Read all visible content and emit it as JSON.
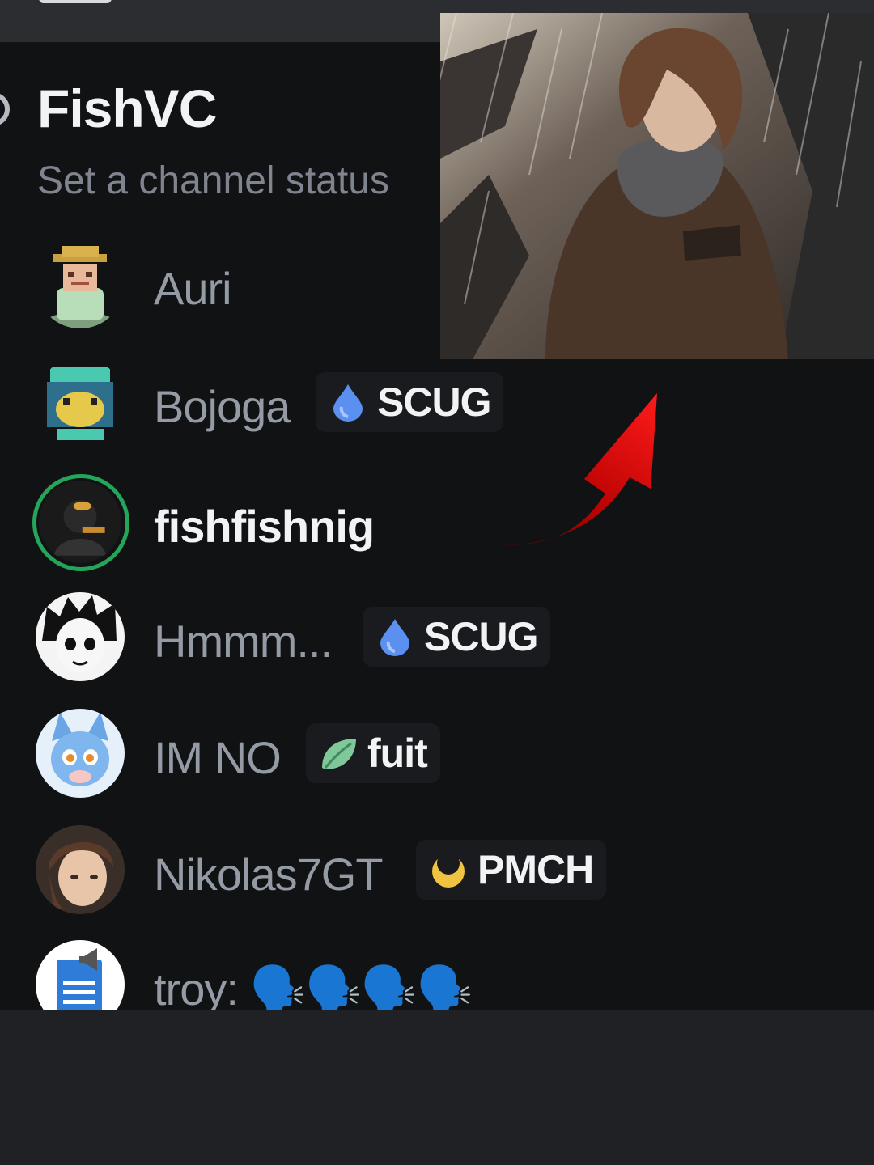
{
  "channel": {
    "name": "FishVC",
    "status_placeholder": "Set a channel status"
  },
  "members": [
    {
      "name": "Auri",
      "avatar": "pixel-straw-hat-avatar"
    },
    {
      "name": "Bojoga",
      "avatar": "pixel-frog-avatar",
      "tag": {
        "icon": "water-drop-icon",
        "label": "SCUG"
      }
    },
    {
      "name": "fishfishnig",
      "avatar": "dark-silhouette-avatar",
      "speaking": true
    },
    {
      "name": "Hmmm...",
      "avatar": "anime-boy-avatar",
      "tag": {
        "icon": "water-drop-icon",
        "label": "SCUG"
      }
    },
    {
      "name": "IM NO",
      "avatar": "blue-fox-avatar",
      "tag": {
        "icon": "leaf-icon",
        "label": "fuit"
      }
    },
    {
      "name": "Nikolas7GT",
      "avatar": "brown-hair-avatar",
      "tag": {
        "icon": "crescent-moon-icon",
        "label": "PMCH"
      }
    },
    {
      "name": "troy: 🗣️🗣️🗣️🗣️",
      "avatar": "document-speaker-avatar"
    }
  ],
  "colors": {
    "speaking_ring": "#23a55a",
    "water_drop": "#5b8ff0",
    "leaf": "#7ec89a",
    "moon": "#f0c441",
    "arrow": "#e01b1b"
  }
}
